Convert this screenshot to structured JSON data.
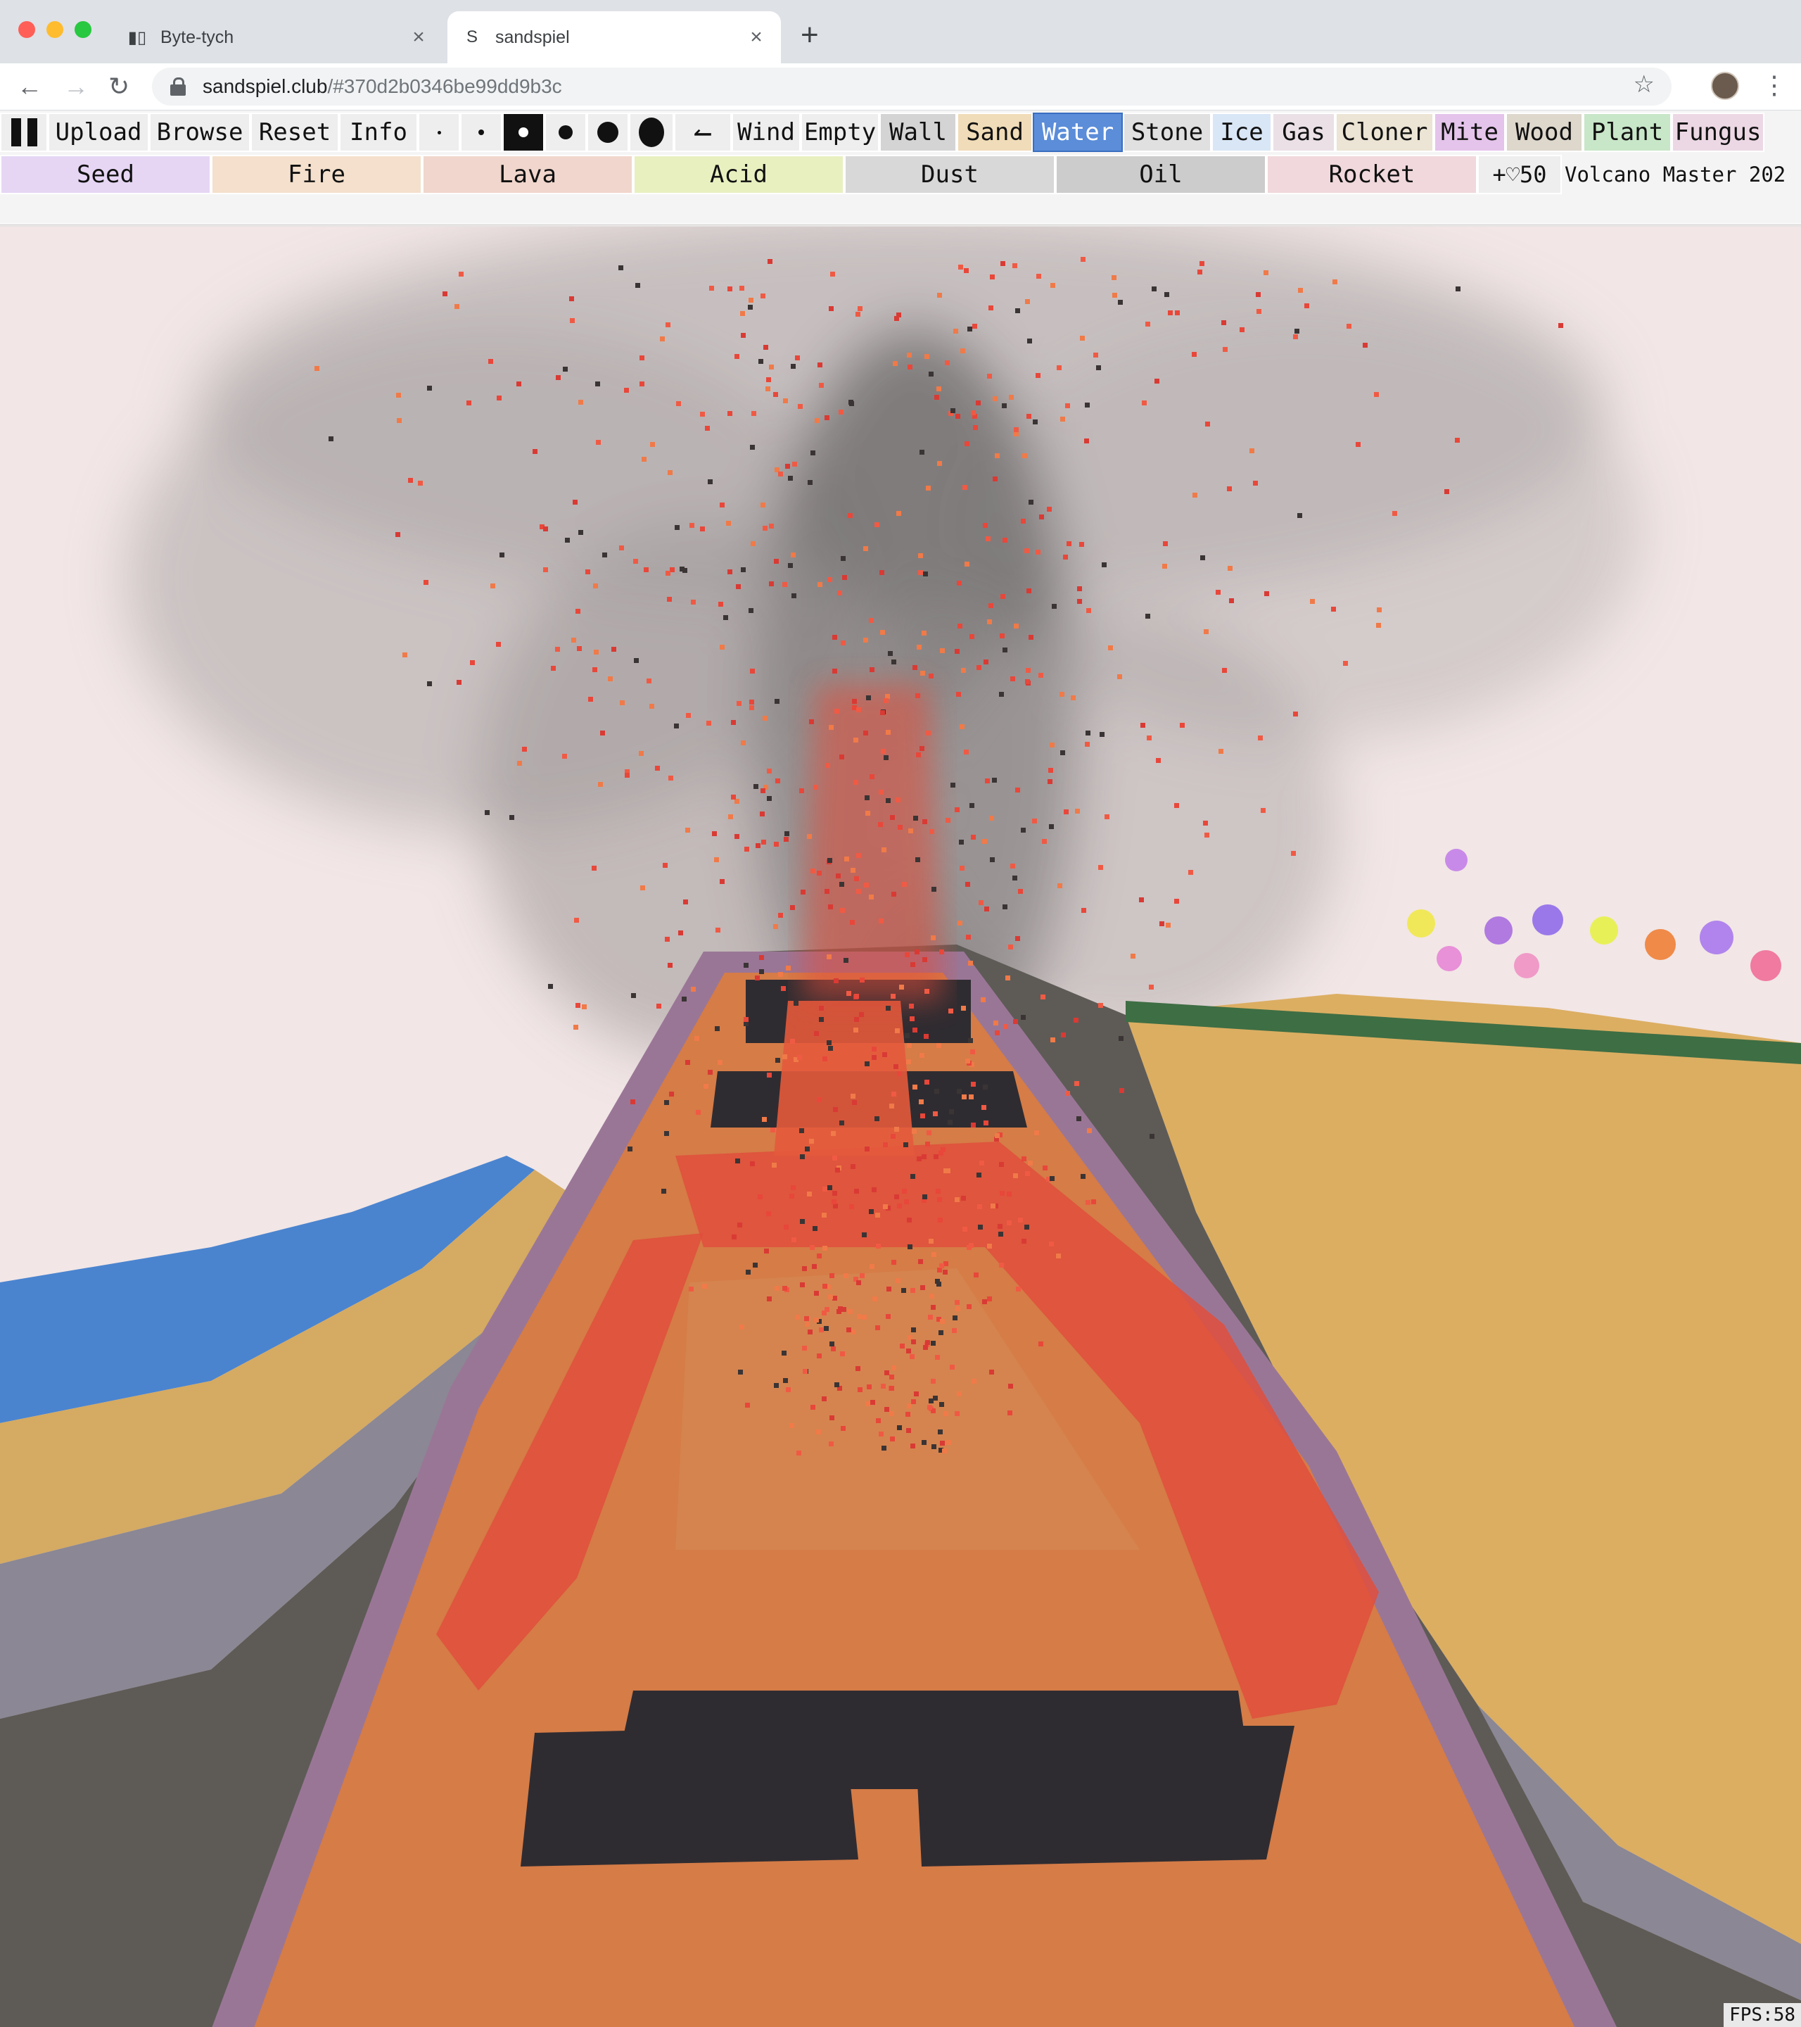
{
  "browser": {
    "tabs": [
      {
        "title": "Byte-tych",
        "favicon": "book-icon",
        "active": false
      },
      {
        "title": "sandspiel",
        "favicon": "S",
        "active": true
      }
    ],
    "new_tab": "+",
    "url_host": "sandspiel.club",
    "url_path": "/#370d2b0346be99dd9b3c"
  },
  "toolbar": {
    "actions": [
      "Upload",
      "Browse",
      "Reset",
      "Info"
    ],
    "brush_sizes": [
      1,
      2,
      3,
      4,
      5,
      6
    ],
    "active_brush_size": 3,
    "row1_elements": [
      "Wind",
      "Empty",
      "Wall",
      "Sand",
      "Water",
      "Stone",
      "Ice",
      "Gas",
      "Cloner",
      "Mite",
      "Wood",
      "Plant",
      "Fungus"
    ],
    "row2_elements": [
      "Seed",
      "Fire",
      "Lava",
      "Acid",
      "Dust",
      "Oil",
      "Rocket"
    ],
    "selected_element": "Water",
    "favorite": {
      "count": "+♡50"
    },
    "creation_title": "Volcano Master 202"
  },
  "element_colors": {
    "Wall": "#d4d4d4",
    "Sand": "#f0dcb8",
    "Water": "#5b8dd8",
    "Stone": "#e0e0e0",
    "Ice": "#d9e6f5",
    "Gas": "#eae0e6",
    "Cloner": "#ece4d4",
    "Mite": "#e4c4ea",
    "Wood": "#ddd7cc",
    "Plant": "#c8e6c8",
    "Fungus": "#ecd8e4",
    "Seed": "#e6d6f4",
    "Fire": "#f4e0cc",
    "Lava": "#f0d6cc",
    "Acid": "#e8f0c0",
    "Dust": "#d8d8d8",
    "Oil": "#cccccc",
    "Rocket": "#f0d8dc"
  },
  "status": {
    "fps": "FPS:58"
  }
}
